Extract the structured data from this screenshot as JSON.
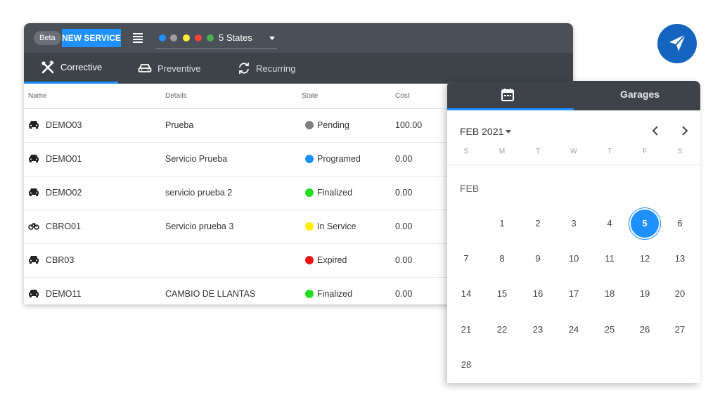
{
  "toolbar": {
    "beta_label": "Beta",
    "new_service_label": "NEW SERVICE",
    "states_label": "5 States",
    "state_colors": [
      "#1e90ff",
      "#9e9e9e",
      "#ffeb3b",
      "#f44336",
      "#4caf50"
    ]
  },
  "tabs": [
    {
      "label": "Corrective",
      "icon": "tools-icon",
      "active": true
    },
    {
      "label": "Preventive",
      "icon": "car-icon",
      "active": false
    },
    {
      "label": "Recurring",
      "icon": "refresh-icon",
      "active": false
    }
  ],
  "table": {
    "headers": [
      "Name",
      "Details",
      "State",
      "Cost"
    ],
    "rows": [
      {
        "vehicle_icon": "car-icon",
        "name": "DEMO03",
        "details": "Prueba",
        "state": "Pending",
        "state_color": "#808080",
        "cost": "100.00"
      },
      {
        "vehicle_icon": "car-icon",
        "name": "DEMO01",
        "details": "Servicio Prueba",
        "state": "Programed",
        "state_color": "#1e90ff",
        "cost": "0.00"
      },
      {
        "vehicle_icon": "car-icon",
        "name": "DEMO02",
        "details": "servicio prueba 2",
        "state": "Finalized",
        "state_color": "#22dd22",
        "cost": "0.00"
      },
      {
        "vehicle_icon": "bicycle-icon",
        "name": "CBRO01",
        "details": "Servicio prueba 3",
        "state": "In Service",
        "state_color": "#ffee00",
        "cost": "0.00"
      },
      {
        "vehicle_icon": "car-icon",
        "name": "CBR03",
        "details": "",
        "state": "Expired",
        "state_color": "#ee1111",
        "cost": "0.00"
      },
      {
        "vehicle_icon": "car-icon",
        "name": "DEMO11",
        "details": "CAMBIO DE LLANTAS",
        "state": "Finalized",
        "state_color": "#22dd22",
        "cost": "0.00"
      }
    ]
  },
  "calendar": {
    "tab_icon": "calendar-icon",
    "garages_label": "Garages",
    "month_label": "FEB 2021",
    "weekdays": [
      "S",
      "M",
      "T",
      "W",
      "T",
      "F",
      "S"
    ],
    "section_label": "FEB",
    "weeks": [
      [
        "",
        "1",
        "2",
        "3",
        "4",
        "5",
        "6"
      ],
      [
        "7",
        "8",
        "9",
        "10",
        "11",
        "12",
        "13"
      ],
      [
        "14",
        "15",
        "16",
        "17",
        "18",
        "19",
        "20"
      ],
      [
        "21",
        "22",
        "23",
        "24",
        "25",
        "26",
        "27"
      ],
      [
        "28",
        "",
        "",
        "",
        "",
        "",
        ""
      ]
    ],
    "selected_day": "5"
  },
  "logo": {
    "icon": "navigation-arrow-icon",
    "color": "#1565c0"
  }
}
